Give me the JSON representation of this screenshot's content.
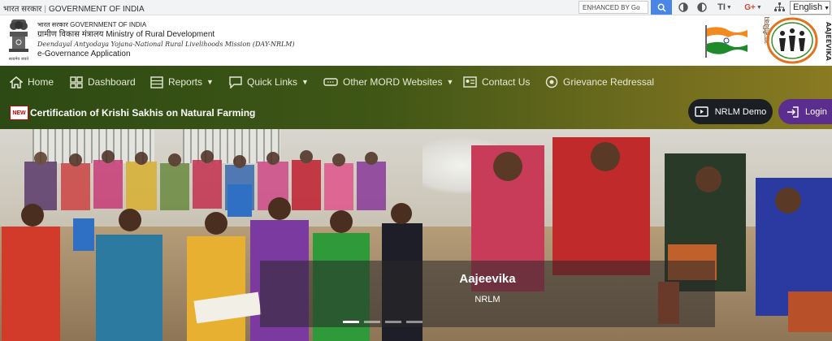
{
  "topbar": {
    "gov_hindi": "भारत सरकार",
    "gov_english": "GOVERNMENT OF INDIA",
    "search_placeholder": "ENHANCED BY Go",
    "language": "English"
  },
  "header": {
    "gov_hindi": "भारत सरकार",
    "gov_english": "GOVERNMENT OF INDIA",
    "ministry_hindi": "ग्रामीण विकास मंत्रालय",
    "ministry_english": "Ministry of Rural Development",
    "mission": "Deendayal Antyodaya Yojana-National Rural Livelihoods Mission (DAY-NRLM)",
    "app_name": "e-Governance Application",
    "emblem_motto": "सत्यमेव जयते",
    "logo_text_hi": "आजीविका",
    "logo_text_en": "AAJEEVIKA"
  },
  "nav": {
    "items": [
      {
        "label": "Home",
        "icon": "home-icon"
      },
      {
        "label": "Dashboard",
        "icon": "dashboard-icon"
      },
      {
        "label": "Reports",
        "icon": "reports-icon",
        "dropdown": true
      },
      {
        "label": "Quick Links",
        "icon": "quick-links-icon",
        "dropdown": true
      },
      {
        "label": "Other MORD Websites",
        "icon": "link-icon",
        "dropdown": true
      },
      {
        "label": "Contact Us",
        "icon": "contact-icon"
      },
      {
        "label": "Grievance Redressal",
        "icon": "grievance-icon"
      }
    ],
    "new_badge": "NEW",
    "announcement": "Certification of Krishi Sakhis on Natural Farming",
    "demo_button": "NRLM Demo",
    "login_button": "Login"
  },
  "hero": {
    "title": "Aajeevika",
    "subtitle": "NRLM",
    "slide_count": 4,
    "active_slide": 1
  },
  "colors": {
    "nav_start": "#2d4a14",
    "nav_end": "#8a7a22",
    "search_button": "#4a86e8",
    "login_button": "#5b2d8e",
    "demo_button": "#1b1f24"
  }
}
